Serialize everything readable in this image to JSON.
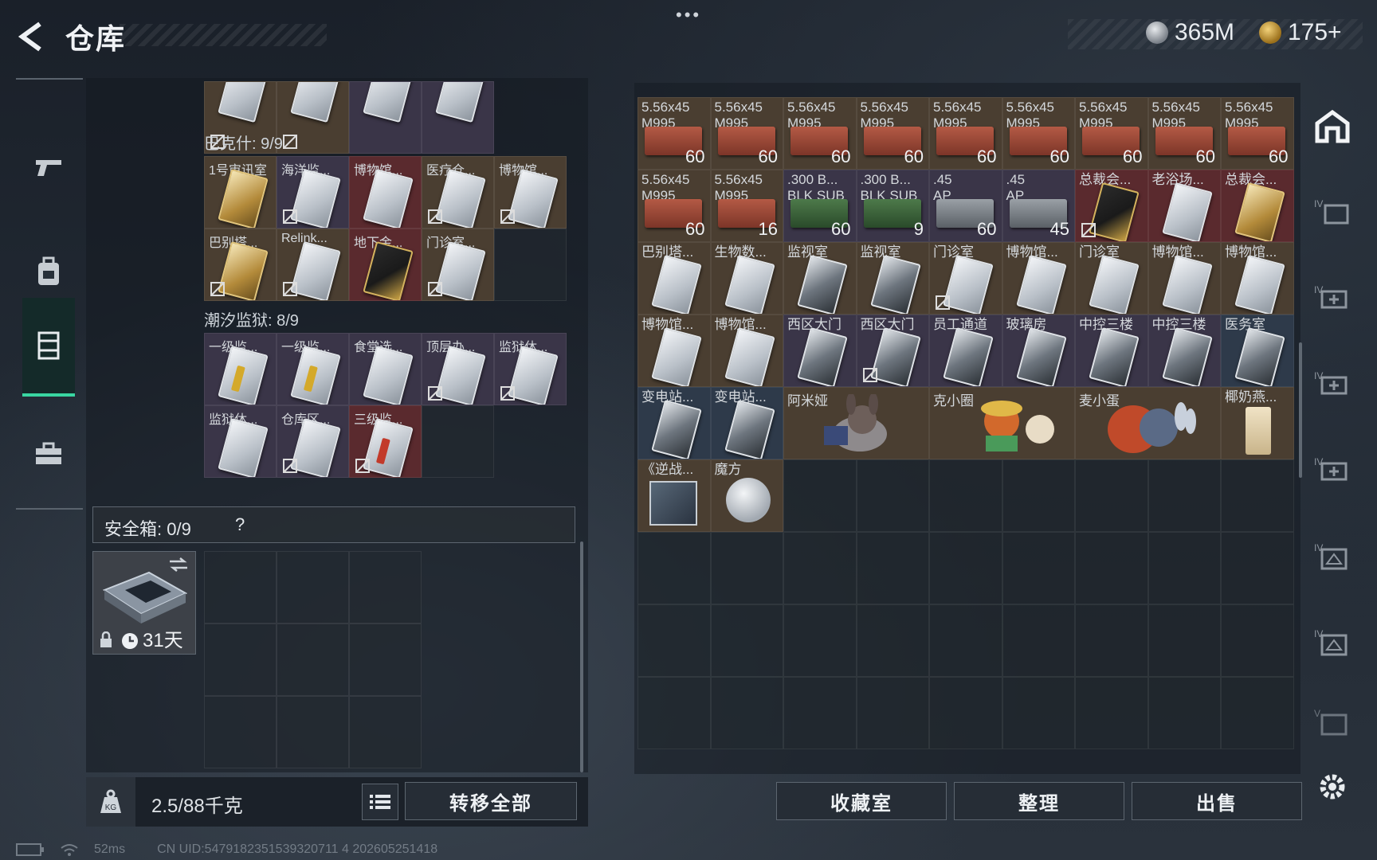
{
  "header": {
    "title": "仓库",
    "more": "•••",
    "currency_silver": "365M",
    "currency_gold": "175+"
  },
  "left": {
    "top_row": [
      "",
      "",
      "",
      ""
    ],
    "section1_title": "巴克什: 9/9",
    "section1": [
      "1号审讯室",
      "海洋监...",
      "博物馆...",
      "医疗仓...",
      "博物馆...",
      "巴别塔...",
      "Relink...",
      "地下金...",
      "门诊室..."
    ],
    "section2_title": "潮汐监狱: 8/9",
    "section2": [
      "一级监...",
      "一级监...",
      "食堂选...",
      "顶层办...",
      "监狱休...",
      "监狱休...",
      "仓库区...",
      "三级监..."
    ],
    "safebox_label": "安全箱: 0/9",
    "safebox_help": "?",
    "safebox_days": "31天",
    "weight": "2.5/88千克",
    "transfer_all": "转移全部"
  },
  "right": {
    "row1_label": "5.56x45",
    "row1_sub": "M995",
    "row1_counts": [
      "60",
      "60",
      "60",
      "60",
      "60",
      "60",
      "60",
      "60",
      "60"
    ],
    "row2": [
      {
        "l1": "5.56x45",
        "l2": "M995",
        "c": "60"
      },
      {
        "l1": "5.56x45",
        "l2": "M995",
        "c": "16"
      },
      {
        "l1": ".300 B...",
        "l2": "BLK SUB",
        "c": "60"
      },
      {
        "l1": ".300 B...",
        "l2": "BLK SUB",
        "c": "9"
      },
      {
        "l1": ".45",
        "l2": "AP",
        "c": "60"
      },
      {
        "l1": ".45",
        "l2": "AP",
        "c": "45"
      },
      {
        "l1": "总裁会...",
        "l2": "",
        "c": ""
      },
      {
        "l1": "老浴场...",
        "l2": "",
        "c": ""
      },
      {
        "l1": "总裁会...",
        "l2": "",
        "c": ""
      }
    ],
    "row3": [
      "巴别塔...",
      "生物数...",
      "监视室",
      "监视室",
      "门诊室",
      "博物馆...",
      "门诊室",
      "博物馆...",
      "博物馆..."
    ],
    "row4": [
      "博物馆...",
      "博物馆...",
      "西区大门",
      "西区大门",
      "员工通道",
      "玻璃房",
      "中控三楼",
      "中控三楼",
      "医务室"
    ],
    "row5": [
      "变电站...",
      "变电站...",
      "阿米娅",
      "克小圈",
      "麦小蛋",
      "椰奶燕..."
    ],
    "row6": [
      "《逆战...",
      "魔方"
    ],
    "btn_collection": "收藏室",
    "btn_sort": "整理",
    "btn_sell": "出售"
  },
  "status": {
    "ping": "52ms",
    "uid": "CN UID:5479182351539320711 4 202605251418"
  }
}
